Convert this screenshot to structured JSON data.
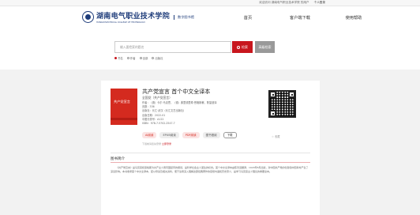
{
  "topbar": {
    "welcome": "欢迎访问 湖南电气职业技术学院 的用户",
    "login": "个人登录"
  },
  "header": {
    "school_cn": "湖南电气职业技术学院",
    "school_en": "HUNAN ELECTRICAL COLLEGE OF TECHNOLOGY",
    "library": "数字图书馆"
  },
  "nav": {
    "items": [
      "首页",
      "客户端下载",
      "使用帮助"
    ]
  },
  "search": {
    "placeholder": "输入要检索的题名",
    "search_label": "检索",
    "advanced_label": "高级检索",
    "options": [
      "书名",
      "作者",
      "全部",
      "出版社"
    ],
    "selected_option": "书名"
  },
  "book": {
    "title": "共产党宣言 首个中文全译本",
    "cover_title": "共产党宣言",
    "author": "全国党（共产党宣言）",
    "meta_lines": [
      "作者：（德）卡尔·马克思，（德）弗里德里希·恩格斯著，陈望道译",
      "页数：336",
      "出版社：长江·武汉（长江文艺出版社）",
      "出版日期：2022-01",
      "中图分类号：A122",
      "ISBN：978-7-5702-2547-7"
    ],
    "buttons": [
      "AI阅读",
      "EPUB阅读",
      "PDF阅读",
      "图书借阅",
      "下载"
    ],
    "collect": "收藏",
    "hint_text": "下载前请您先登录",
    "hint_link": "立即登录"
  },
  "intro": {
    "heading": "图书简介",
    "text": "《共产党宣言》是马克思和恩格斯为共产主义者同盟起草的纲领，是科学社会主义诞生的标志。首个中文全译本由陈望道翻译，1920年8月出版，对中国共产党的创建和中国革命产生了深远影响。本书收录首个中文全译本，配以导读及相关资料，便于读者深入理解这部经典著作的思想内涵和历史意义，是学习马克思主义理论的重要读本。"
  },
  "colors": {
    "brand": "#1e3c7a",
    "accent": "#c8161d"
  }
}
